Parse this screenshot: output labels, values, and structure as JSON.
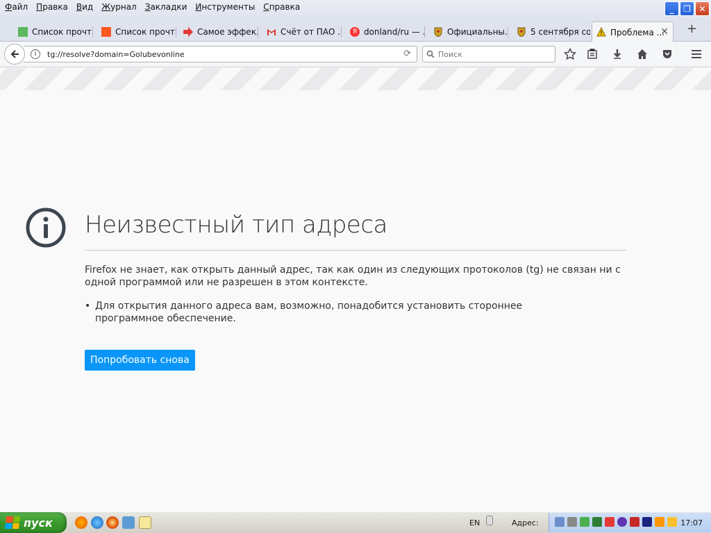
{
  "menubar": {
    "items": [
      "Файл",
      "Правка",
      "Вид",
      "Журнал",
      "Закладки",
      "Инструменты",
      "Справка"
    ]
  },
  "tabs": [
    {
      "label": "Список прочт...",
      "favicon": "green-square-icon",
      "color": "#5cb85c"
    },
    {
      "label": "Список прочт...",
      "favicon": "orange-square-icon",
      "color": "#ff5722"
    },
    {
      "label": "Самое эффек...",
      "favicon": "red-arrow-icon",
      "color": "#e53935"
    },
    {
      "label": "Счёт от ПАО ...",
      "favicon": "gmail-icon",
      "color": "#d93025"
    },
    {
      "label": "donland/ru — ...",
      "favicon": "yandex-icon",
      "color": "#f33"
    },
    {
      "label": "Официальны...",
      "favicon": "emblem-icon",
      "color": "#b8860b"
    },
    {
      "label": "5 сентября со...",
      "favicon": "emblem-icon",
      "color": "#b8860b"
    },
    {
      "label": "Проблема ...",
      "favicon": "warning-icon",
      "color": "#f0c000"
    }
  ],
  "navbar": {
    "url": "tg://resolve?domain=Golubevonline",
    "search_placeholder": "Поиск"
  },
  "error_page": {
    "title": "Неизвестный тип адреса",
    "description": "Firefox не знает, как открыть данный адрес, так как один из следующих протоколов (tg) не связан ни с одной программой или не разрешен в этом контексте.",
    "bullet": "Для открытия данного адреса вам, возможно, понадобится установить стороннее программное обеспечение.",
    "retry_label": "Попробовать снова",
    "accent_color": "#0996f8"
  },
  "taskbar": {
    "start_label": "пуск",
    "language": "EN",
    "address_label": "Адрес:",
    "clock": "17:07"
  }
}
